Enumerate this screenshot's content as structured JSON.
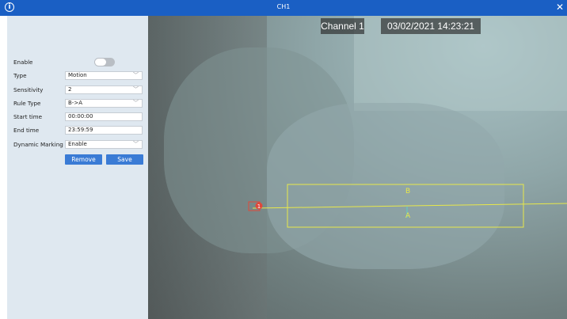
{
  "titlebar": {
    "title": "CH1",
    "info_icon": "info-icon",
    "close_icon": "close-icon"
  },
  "settings": {
    "enable": {
      "label": "Enable",
      "on": false
    },
    "type": {
      "label": "Type",
      "value": "Motion"
    },
    "sensitivity": {
      "label": "Sensitivity",
      "value": "2"
    },
    "rule_type": {
      "label": "Rule Type",
      "value": "B->A"
    },
    "start_time": {
      "label": "Start time",
      "value": "00:00:00"
    },
    "end_time": {
      "label": "End time",
      "value": "23:59:59"
    },
    "dynamic_marking": {
      "label": "Dynamic Marking",
      "value": "Enable"
    },
    "remove_label": "Remove",
    "save_label": "Save"
  },
  "video": {
    "channel_label": "Channel 1",
    "datetime": "03/02/2021 14:23:21",
    "zone_label_b": "B",
    "zone_label_a": "A",
    "line_marker": "1",
    "zone_color": "#e8e84a",
    "marker_color": "#e0483a"
  }
}
